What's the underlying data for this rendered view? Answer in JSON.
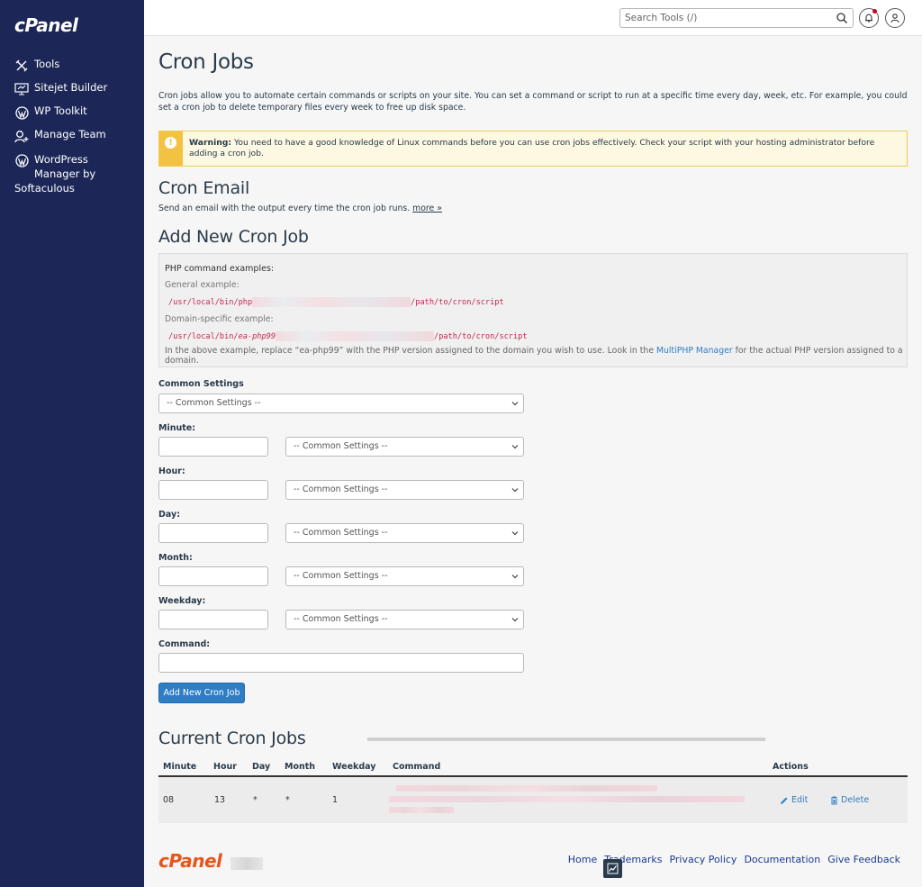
{
  "brand": {
    "logo_text": "cPanel",
    "accent": "#2f7ec3",
    "sidebar_bg": "#1c2757",
    "footer_logo_color": "#e8551b"
  },
  "sidebar": {
    "items": [
      {
        "label": "Tools",
        "icon": "tools-icon"
      },
      {
        "label": "Sitejet Builder",
        "icon": "sitejet-icon"
      },
      {
        "label": "WP Toolkit",
        "icon": "wordpress-icon"
      },
      {
        "label": "Manage Team",
        "icon": "user-add-icon"
      },
      {
        "label_line1": "WordPress",
        "label_line2": "Manager by",
        "label_line3": "Softaculous",
        "icon": "wordpress-icon"
      }
    ]
  },
  "topbar": {
    "search_placeholder": "Search Tools (/)"
  },
  "page": {
    "title": "Cron Jobs",
    "intro": "Cron jobs allow you to automate certain commands or scripts on your site. You can set a command or script to run at a specific time every day, week, etc. For example, you could set a cron job to delete temporary files every week to free up disk space.",
    "warning_label": "Warning:",
    "warning_text": " You need to have a good knowledge of Linux commands before you can use cron jobs effectively. Check your script with your hosting administrator before adding a cron job."
  },
  "cron_email": {
    "heading": "Cron Email",
    "desc": "Send an email with the output every time the cron job runs. ",
    "more_link": "more »"
  },
  "add_cron": {
    "heading": "Add New Cron Job",
    "examples_title": "PHP command examples:",
    "general_label": "General example:",
    "general_prefix": "/usr/local/bin/php",
    "general_suffix": "/path/to/cron/script",
    "domain_label": "Domain-specific example:",
    "domain_prefix": "/usr/local/bin/",
    "domain_version": "ea-php99",
    "domain_suffix": "/path/to/cron/script",
    "note_before": "In the above example, replace “ea-php99” with the PHP version assigned to the domain you wish to use. Look in the ",
    "note_link": "MultiPHP Manager",
    "note_after": " for the actual PHP version assigned to a domain.",
    "common_settings_label": "Common Settings",
    "select_default": "-- Common Settings --",
    "minute_label": "Minute:",
    "hour_label": "Hour:",
    "day_label": "Day:",
    "month_label": "Month:",
    "weekday_label": "Weekday:",
    "command_label": "Command:",
    "submit_label": "Add New Cron Job"
  },
  "current": {
    "heading": "Current Cron Jobs",
    "columns": [
      "Minute",
      "Hour",
      "Day",
      "Month",
      "Weekday",
      "Command",
      "Actions"
    ],
    "rows": [
      {
        "minute": "08",
        "hour": "13",
        "day": "*",
        "month": "*",
        "weekday": "1",
        "edit": "Edit",
        "delete": "Delete"
      }
    ]
  },
  "footer": {
    "logo_text": "cPanel",
    "links": [
      "Home",
      "Trademarks",
      "Privacy Policy",
      "Documentation",
      "Give Feedback"
    ]
  }
}
